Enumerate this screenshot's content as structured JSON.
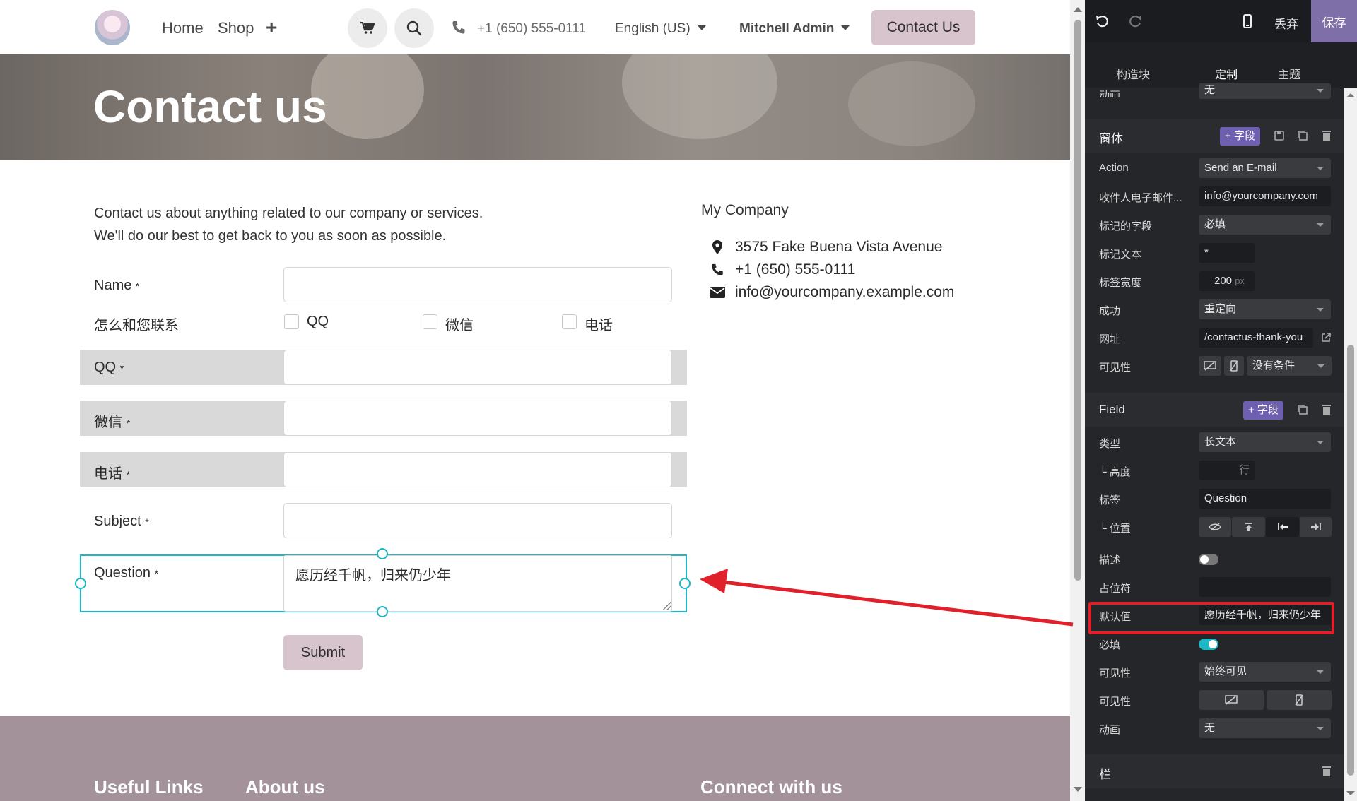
{
  "navbar": {
    "links": [
      "Home",
      "Shop"
    ],
    "phone": "+1 (650) 555-0111",
    "language": "English (US)",
    "user": "Mitchell Admin",
    "contact_button": "Contact Us"
  },
  "hero": {
    "title": "Contact us"
  },
  "intro": {
    "line1": "Contact us about anything related to our company or services.",
    "line2": "We'll do our best to get back to you as soon as possible."
  },
  "company": {
    "name": "My Company",
    "address": "3575 Fake Buena Vista Avenue",
    "phone": "+1 (650) 555-0111",
    "email": "info@yourcompany.example.com"
  },
  "form": {
    "name_label": "Name",
    "contact_method_label": "怎么和您联系",
    "options": [
      "QQ",
      "微信",
      "电话"
    ],
    "qq_label": "QQ",
    "wechat_label": "微信",
    "phone_label": "电话",
    "subject_label": "Subject",
    "question_label": "Question",
    "question_value": "愿历经千帆，归来仍少年",
    "required_mark": "*",
    "submit": "Submit"
  },
  "footer": {
    "useful_links": "Useful Links",
    "about_us": "About us",
    "connect": "Connect with us"
  },
  "editor": {
    "discard": "丢弃",
    "save": "保存",
    "tabs": [
      "构造块",
      "定制",
      "主题"
    ],
    "active_tab": "定制",
    "top_partial": {
      "label": "动画",
      "value": "无"
    },
    "form_section": {
      "title": "窗体",
      "add_field": "+ 字段",
      "rows": {
        "action_label": "Action",
        "action_value": "Send an E-mail",
        "recipient_label": "收件人电子邮件...",
        "recipient_value": "info@yourcompany.com",
        "marked_fields_label": "标记的字段",
        "marked_fields_value": "必填",
        "mark_text_label": "标记文本",
        "mark_text_value": "*",
        "label_width_label": "标签宽度",
        "label_width_value": "200",
        "label_width_unit": "px",
        "success_label": "成功",
        "success_value": "重定向",
        "url_label": "网址",
        "url_value": "/contactus-thank-you",
        "visibility_label": "可见性",
        "visibility_value": "没有条件"
      }
    },
    "field_section": {
      "title": "Field",
      "add_field": "+ 字段",
      "rows": {
        "type_label": "类型",
        "type_value": "长文本",
        "height_label": "└ 高度",
        "height_unit": "行",
        "label_label": "标签",
        "label_value": "Question",
        "position_label": "└ 位置",
        "description_label": "描述",
        "placeholder_label": "占位符",
        "placeholder_value": "",
        "default_label": "默认值",
        "default_value": "愿历经千帆，归来仍少年",
        "required_label": "必填",
        "visibility_label": "可见性",
        "visibility_value": "始终可见",
        "visibility2_label": "可见性",
        "animation_label": "动画",
        "animation_value": "无"
      }
    },
    "column_section": {
      "title": "栏"
    }
  }
}
